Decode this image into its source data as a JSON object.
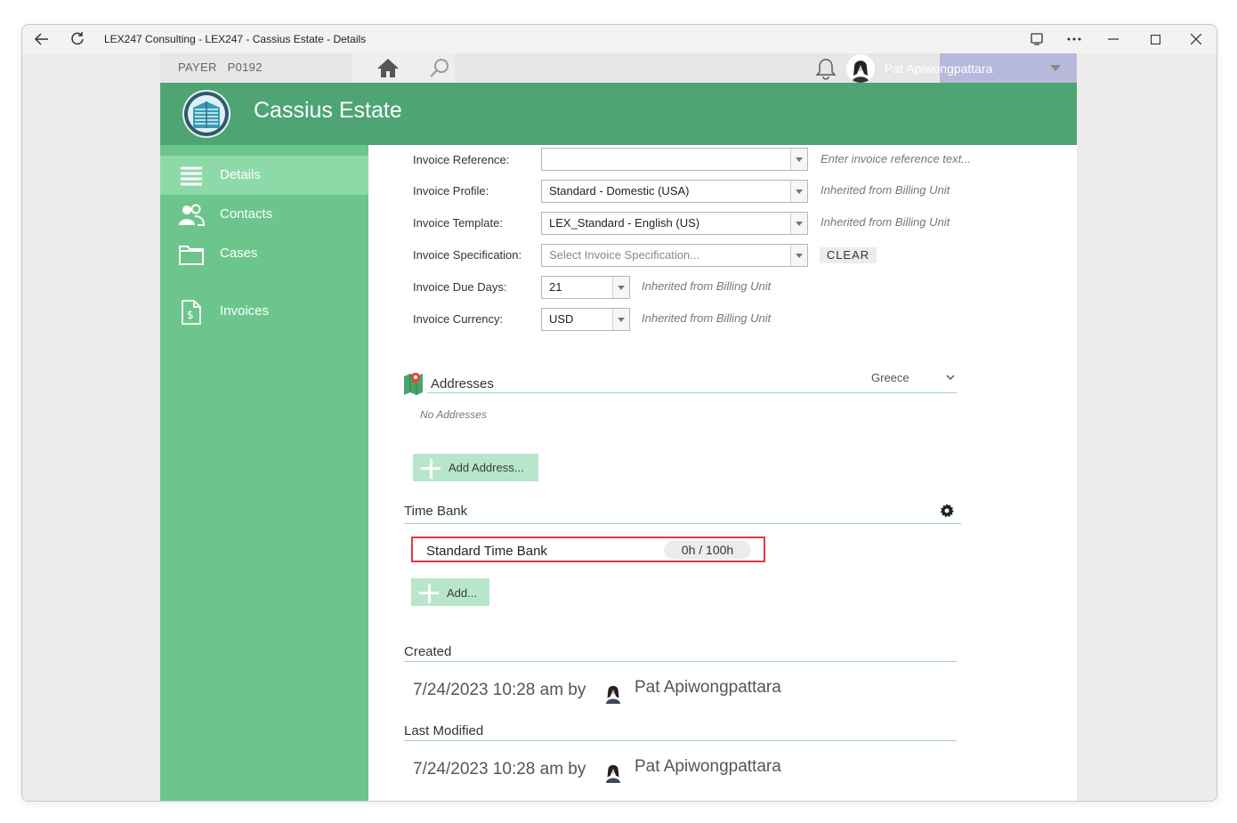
{
  "window": {
    "title": "LEX247 Consulting - LEX247 - Cassius Estate - Details"
  },
  "topbar": {
    "payer_label": "PAYER",
    "payer_code": "P0192",
    "user_name": "Pat Apiwongpattara"
  },
  "header": {
    "title": "Cassius Estate"
  },
  "sidebar": {
    "items": [
      {
        "label": "Details",
        "icon": "list-icon",
        "active": true
      },
      {
        "label": "Contacts",
        "icon": "people-icon",
        "active": false
      },
      {
        "label": "Cases",
        "icon": "folder-icon",
        "active": false
      },
      {
        "label": "Invoices",
        "icon": "invoice-icon",
        "active": false
      }
    ]
  },
  "invoice": {
    "reference": {
      "label": "Invoice Reference:",
      "value": "",
      "hint": "Enter invoice reference text..."
    },
    "profile": {
      "label": "Invoice Profile:",
      "value": "Standard - Domestic (USA)",
      "hint": "Inherited from Billing Unit"
    },
    "template": {
      "label": "Invoice Template:",
      "value": "LEX_Standard - English (US)",
      "hint": "Inherited from Billing Unit"
    },
    "specification": {
      "label": "Invoice Specification:",
      "placeholder": "Select Invoice Specification...",
      "clear_label": "CLEAR"
    },
    "due_days": {
      "label": "Invoice Due Days:",
      "value": "21",
      "hint": "Inherited from Billing Unit"
    },
    "currency": {
      "label": "Invoice Currency:",
      "value": "USD",
      "hint": "Inherited from Billing Unit"
    }
  },
  "addresses": {
    "title": "Addresses",
    "country": "Greece",
    "empty_text": "No Addresses",
    "add_label": "Add Address..."
  },
  "time_bank": {
    "title": "Time Bank",
    "entries": [
      {
        "name": "Standard Time Bank",
        "usage": "0h / 100h"
      }
    ],
    "add_label": "Add..."
  },
  "created": {
    "title": "Created",
    "date": "7/24/2023 10:28 am by",
    "user": "Pat Apiwongpattara"
  },
  "last_modified": {
    "title": "Last Modified",
    "date": "7/24/2023 10:28 am by",
    "user": "Pat Apiwongpattara"
  },
  "colors": {
    "header_green": "#4ea573",
    "sidebar_green": "#6cc68c",
    "active_green": "#8dd9a8",
    "highlight_red": "#e0393e",
    "user_bar": "#b6b8dc"
  }
}
